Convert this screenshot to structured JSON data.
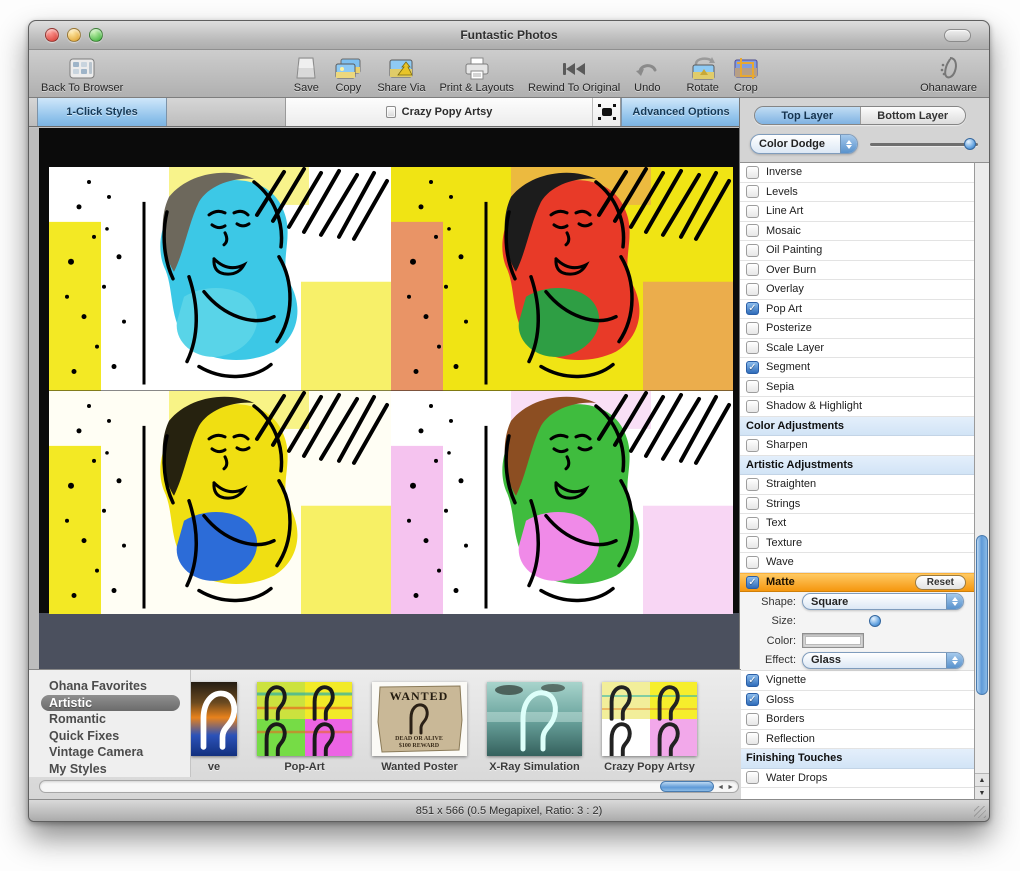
{
  "window": {
    "title": "Funtastic Photos"
  },
  "toolbar": {
    "items": [
      {
        "label": "Back To Browser",
        "icon": "browser-grid-icon"
      },
      {
        "label": "Save",
        "icon": "save-box-icon"
      },
      {
        "label": "Copy",
        "icon": "copy-photos-icon"
      },
      {
        "label": "Share Via",
        "icon": "share-photo-icon"
      },
      {
        "label": "Print & Layouts",
        "icon": "printer-icon"
      },
      {
        "label": "Rewind To Original",
        "icon": "rewind-icon"
      },
      {
        "label": "Undo",
        "icon": "undo-arrow-icon"
      },
      {
        "label": "Rotate",
        "icon": "rotate-photo-icon"
      },
      {
        "label": "Crop",
        "icon": "crop-photo-icon"
      },
      {
        "label": "Ohanaware",
        "icon": "ohanaware-logo-icon"
      }
    ]
  },
  "tabbar": {
    "left": "1-Click Styles",
    "center": "Crazy Popy Artsy",
    "right": "Advanced Options"
  },
  "layer_panel": {
    "tabs": [
      {
        "label": "Top Layer",
        "selected": true
      },
      {
        "label": "Bottom Layer",
        "selected": false
      }
    ],
    "blend_mode": "Color Dodge",
    "blend_amount_pos": 0.96,
    "reset_label": "Reset",
    "effects": [
      {
        "label": "Inverse",
        "checked": false
      },
      {
        "label": "Levels",
        "checked": false
      },
      {
        "label": "Line Art",
        "checked": false
      },
      {
        "label": "Mosaic",
        "checked": false
      },
      {
        "label": "Oil Painting",
        "checked": false
      },
      {
        "label": "Over Burn",
        "checked": false
      },
      {
        "label": "Overlay",
        "checked": false
      },
      {
        "label": "Pop Art",
        "checked": true
      },
      {
        "label": "Posterize",
        "checked": false
      },
      {
        "label": "Scale Layer",
        "checked": false
      },
      {
        "label": "Segment",
        "checked": true
      },
      {
        "label": "Sepia",
        "checked": false
      },
      {
        "label": "Shadow & Highlight",
        "checked": false
      },
      {
        "header": "Color Adjustments"
      },
      {
        "label": "Sharpen",
        "checked": false
      },
      {
        "header": "Artistic Adjustments"
      },
      {
        "label": "Straighten",
        "checked": false
      },
      {
        "label": "Strings",
        "checked": false
      },
      {
        "label": "Text",
        "checked": false
      },
      {
        "label": "Texture",
        "checked": false
      },
      {
        "label": "Wave",
        "checked": false
      },
      {
        "label": "Matte",
        "checked": true,
        "selected": true,
        "reset": true,
        "options": true
      },
      {
        "label": "Vignette",
        "checked": true
      },
      {
        "label": "Gloss",
        "checked": true
      },
      {
        "label": "Borders",
        "checked": false
      },
      {
        "label": "Reflection",
        "checked": false
      },
      {
        "header": "Finishing Touches"
      },
      {
        "label": "Water Drops",
        "checked": false
      }
    ],
    "matte_options": [
      {
        "label": "Shape:",
        "type": "select",
        "value": "Square"
      },
      {
        "label": "Size:",
        "type": "slider",
        "pos": 0.45
      },
      {
        "label": "Color:",
        "type": "colorwell",
        "value": "#ffffff"
      },
      {
        "label": "Effect:",
        "type": "select",
        "value": "Glass"
      }
    ]
  },
  "styles_panel": {
    "categories": [
      {
        "label": "Ohana Favorites",
        "selected": false
      },
      {
        "label": "Artistic",
        "selected": true
      },
      {
        "label": "Romantic",
        "selected": false
      },
      {
        "label": "Quick Fixes",
        "selected": false
      },
      {
        "label": "Vintage Camera",
        "selected": false
      },
      {
        "label": "My Styles",
        "selected": false
      }
    ],
    "thumbnails": [
      {
        "label": "ve",
        "kind": "negative",
        "partial": true
      },
      {
        "label": "Pop-Art",
        "kind": "popart"
      },
      {
        "label": "Wanted Poster",
        "kind": "wanted",
        "poster_title": "WANTED",
        "poster_lines": [
          "DEAD OR ALIVE",
          "$100 REWARD"
        ]
      },
      {
        "label": "X-Ray Simulation",
        "kind": "xray"
      },
      {
        "label": "Crazy Popy Artsy",
        "kind": "crazy"
      }
    ]
  },
  "canvas": {
    "description": "pop-art four-panel portrait of smiling woman",
    "quadrants": [
      {
        "bg": "#ffffff",
        "patch": "#f2e818",
        "skin": "#3cc8e6",
        "hair": "#6d685c",
        "accent": "#59d4e8"
      },
      {
        "bg": "#f0e414",
        "patch": "#e88f6a",
        "skin": "#e83a28",
        "hair": "#1c1c1c",
        "accent": "#2e9e44"
      },
      {
        "bg": "#fffef4",
        "patch": "#f2e818",
        "skin": "#f0df12",
        "hair": "#26220f",
        "accent": "#2c6cd8"
      },
      {
        "bg": "#ffffff",
        "patch": "#f4c0ee",
        "skin": "#3fbc3e",
        "hair": "#8c4e22",
        "accent": "#f08ae8"
      }
    ]
  },
  "status_bar": {
    "text": "851 x 566 (0.5 Megapixel, Ratio: 3 : 2)"
  },
  "icons": {
    "checkmark": "✓",
    "scroll_up": "▲",
    "scroll_down": "▼",
    "hscroll_left": "◄",
    "hscroll_right": "►"
  },
  "colors": {
    "selection_orange": "#f5970f",
    "aqua_blue": "#5e9ad8",
    "tab_blue": "#8cc0ea",
    "canvas_black": "#0b0b0b",
    "canvas_band": "#4b505e"
  }
}
